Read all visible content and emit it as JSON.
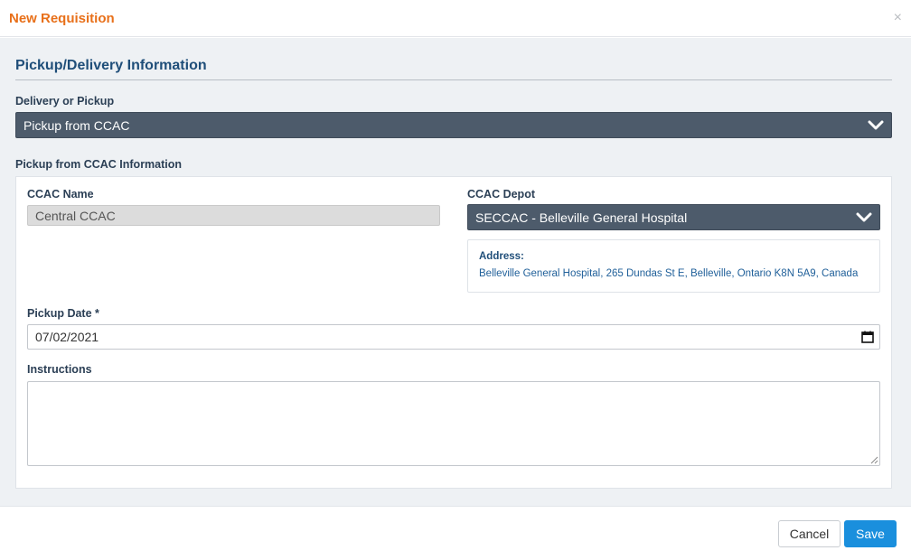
{
  "header": {
    "title": "New Requisition",
    "close_symbol": "×"
  },
  "section": {
    "title": "Pickup/Delivery Information"
  },
  "delivery": {
    "label": "Delivery or Pickup",
    "selected": "Pickup from CCAC"
  },
  "pickup_info": {
    "label": "Pickup from CCAC Information",
    "ccac_name": {
      "label": "CCAC Name",
      "value": "Central CCAC"
    },
    "ccac_depot": {
      "label": "CCAC Depot",
      "selected": "SECCAC - Belleville General Hospital"
    },
    "address": {
      "label": "Address:",
      "text": "Belleville General Hospital, 265 Dundas St E, Belleville, Ontario K8N 5A9, Canada"
    },
    "pickup_date": {
      "label": "Pickup Date *",
      "value": "07/02/2021"
    },
    "instructions": {
      "label": "Instructions",
      "value": ""
    }
  },
  "footer": {
    "cancel_label": "Cancel",
    "save_label": "Save"
  },
  "colors": {
    "title_accent": "#e8701a",
    "select_bg": "#4d5b6b",
    "save_button": "#1a8fdd",
    "section_title": "#1f4e79"
  },
  "icons": {
    "close": "close-icon",
    "dropdown": "chevron-down-icon",
    "calendar": "calendar-icon",
    "resize": "resize-handle-icon"
  }
}
